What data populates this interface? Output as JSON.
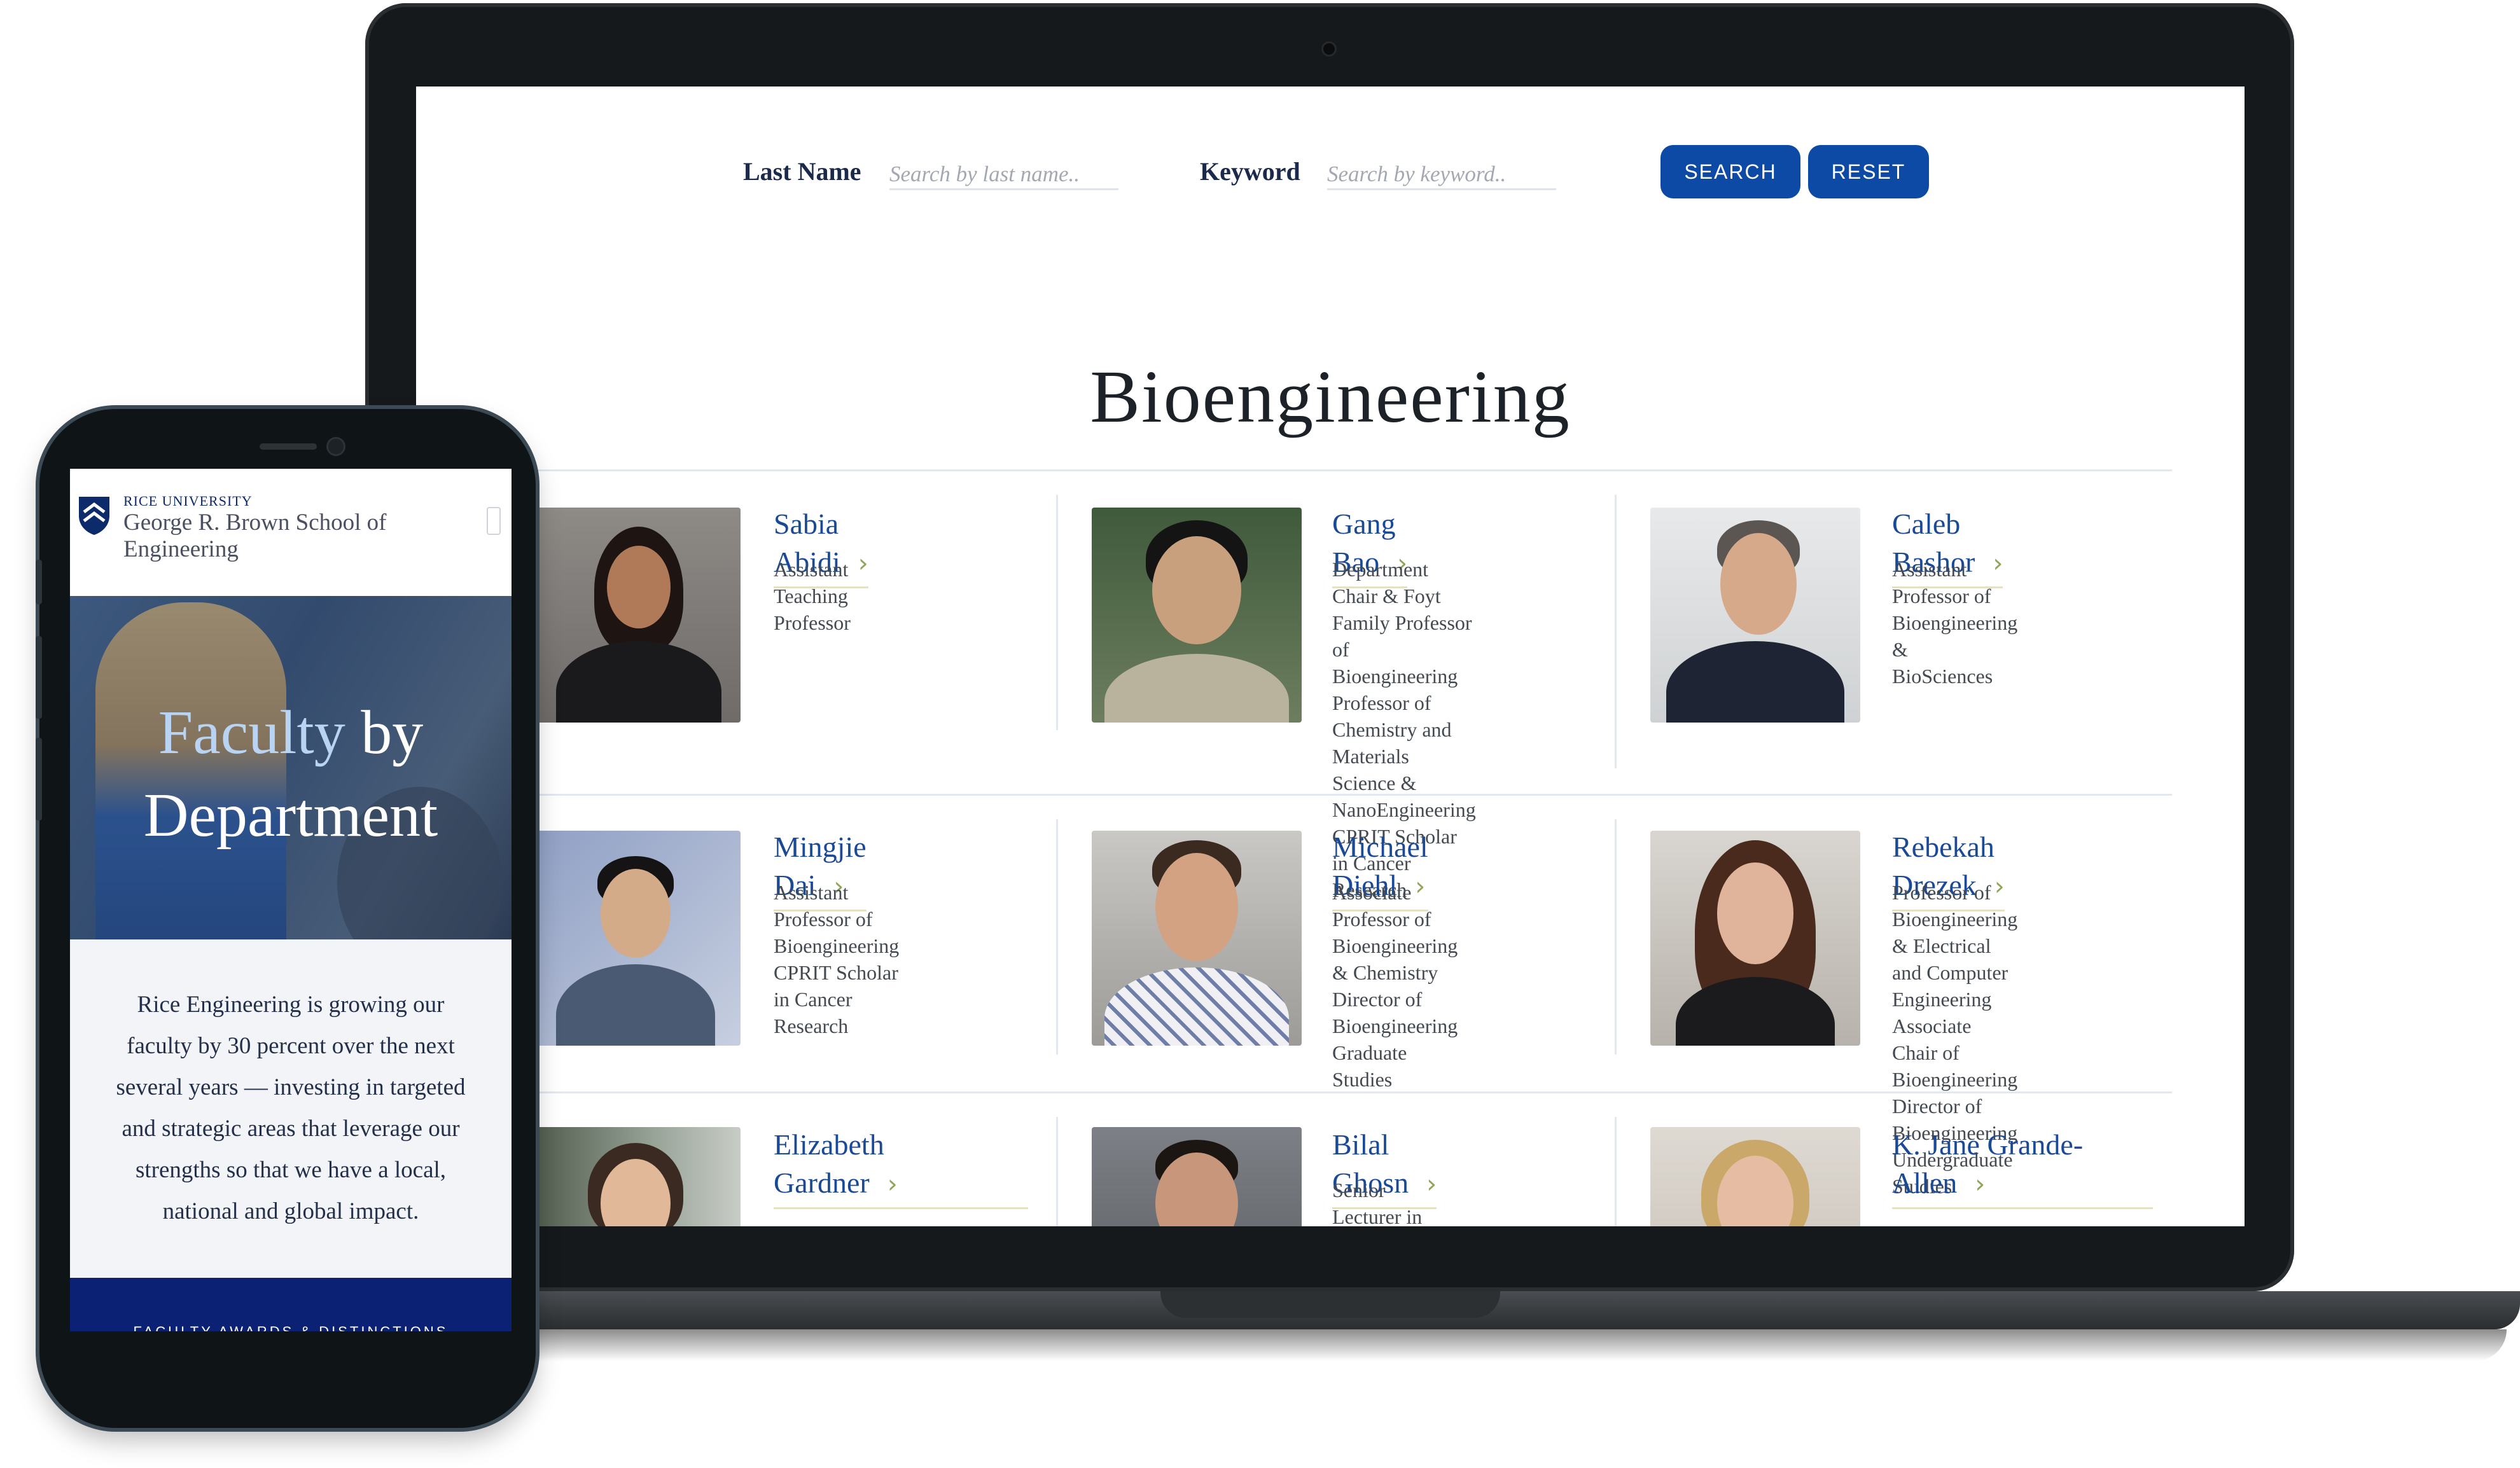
{
  "desktop": {
    "search": {
      "last_name_label": "Last Name",
      "last_name_placeholder": "Search by last name..",
      "keyword_label": "Keyword",
      "keyword_placeholder": "Search by keyword..",
      "search_button": "SEARCH",
      "reset_button": "RESET"
    },
    "department_title": "Bioengineering",
    "faculty": [
      {
        "name": "Sabia Abidi",
        "role": "Assistant Teaching Professor"
      },
      {
        "name": "Gang Bao",
        "role": "Department Chair & Foyt\nFamily Professor of\nBioengineering\nProfessor of Chemistry and\nMaterials Science &\nNanoEngineering\nCPRIT Scholar in Cancer\nResearch"
      },
      {
        "name": "Caleb Bashor",
        "role": "Assistant Professor of\nBioengineering &\nBioSciences"
      },
      {
        "name": "Mingjie Dai",
        "role": "Assistant Professor of\nBioengineering\nCPRIT Scholar in Cancer\nResearch"
      },
      {
        "name": "Michael Diehl",
        "role": "Associate Professor of\nBioengineering & Chemistry\nDirector of Bioengineering\nGraduate Studies"
      },
      {
        "name": "Rebekah Drezek",
        "role": "Professor of Bioengineering\n& Electrical and Computer\nEngineering\nAssociate Chair of\nBioengineering\nDirector of Bioengineering\nUndergraduate Studies"
      },
      {
        "name_line1": "Elizabeth",
        "name_line2": "Gardner",
        "role": ""
      },
      {
        "name": "Bilal Ghosn",
        "role": "Senior Lecturer in\nBioengineering"
      },
      {
        "name_line1": "K. Jane Grande-",
        "name_line2": "Allen",
        "role": ""
      }
    ]
  },
  "mobile": {
    "university": "RICE UNIVERSITY",
    "school": "George R. Brown School of Engineering",
    "hero_title_highlight": "Faculty",
    "hero_title_rest": " by Department",
    "intro": "Rice Engineering is growing our faculty by 30 percent over the next several years — investing in targeted and strategic areas that leverage our strengths so that we have a local, national and global impact.",
    "footer_label": "FACULTY AWARDS & DISTINCTIONS"
  },
  "colors": {
    "brand_blue": "#0c4aa5",
    "name_blue": "#1a4a95",
    "chevron_green": "#8fa55b",
    "footer_navy": "#0b2274"
  },
  "icons": [
    "chevron-right-icon",
    "rice-shield-icon",
    "menu-icon"
  ]
}
